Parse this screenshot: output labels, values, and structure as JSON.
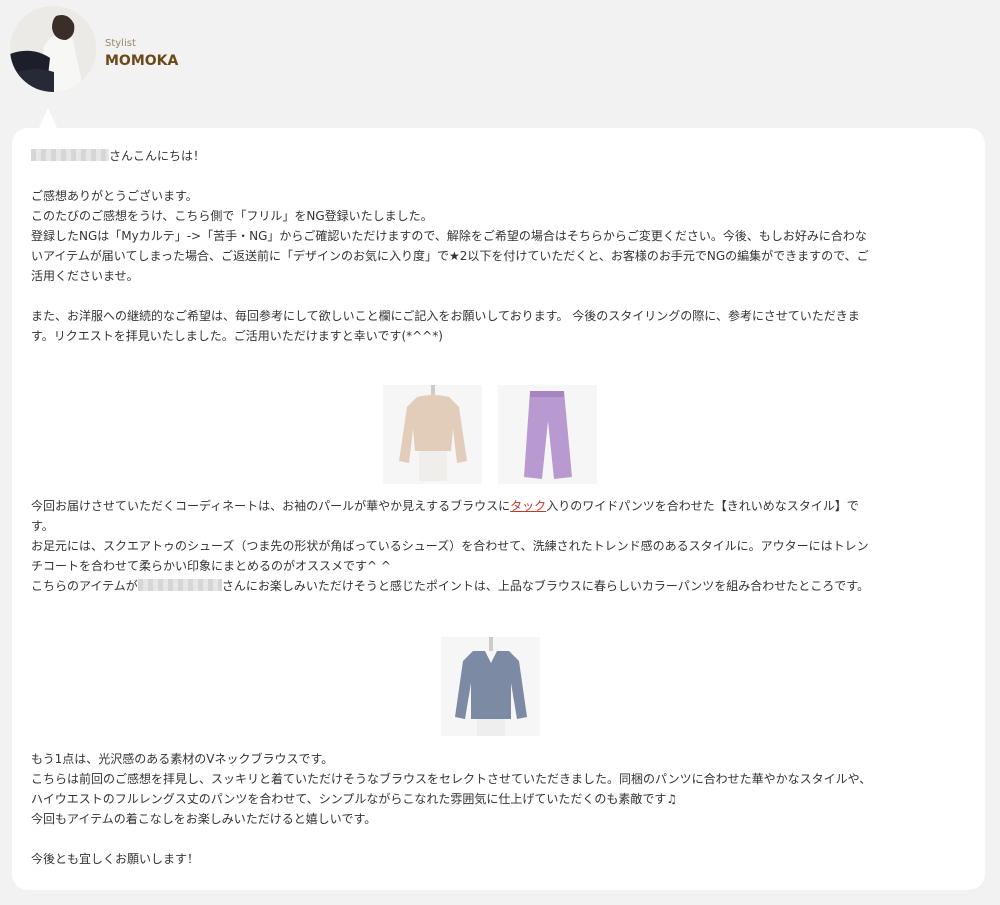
{
  "stylist": {
    "role": "Stylist",
    "name": "MOMOKA",
    "avatar_icon": "stylist-photo"
  },
  "message": {
    "greeting": "さんこんにちは！",
    "p1_l1": "ご感想ありがとうございます。",
    "p1_l2": "このたびのご感想をうけ、こちら側で「フリル」をNG登録いたしました。",
    "p1_l3": "登録したNGは「Myカルテ」->「苦手・NG」からご確認いただけますので、解除をご希望の場合はそちらからご変更ください。今後、もしお好みに合わな",
    "p1_l4": "いアイテムが届いてしまった場合、ご返送前に「デザインのお気に入り度」で★2以下を付けていただくと、お客様のお手元でNGの編集ができますので、ご",
    "p1_l5": "活用くださいませ。",
    "p2_l1": "また、お洋服への継続的なご希望は、毎回参考にして欲しいこと欄にご記入をお願いしております。 今後のスタイリングの際に、参考にさせていただきま",
    "p2_l2": "す。リクエストを拝見いたしました。ご活用いただけますと幸いです(*^^*)",
    "p3_l1_before": "今回お届けさせていただくコーディネートは、お袖のパールが華やか見えするブラウスに",
    "p3_l1_link": "タック",
    "p3_l1_after": "入りのワイドパンツを合わせた【きれいめなスタイル】で",
    "p3_l2": "す。",
    "p3_l3": "お足元には、スクエアトゥのシューズ（つま先の形状が角ばっているシューズ）を合わせて、洗練されたトレンド感のあるスタイルに。アウターにはトレン",
    "p3_l4": "チコートを合わせて柔らかい印象にまとめるのがオススメです^ ^",
    "p3_l5_before": "こちらのアイテムが",
    "p3_l5_after": "さんにお楽しみいただけそうと感じたポイントは、上品なブラウスに春らしいカラーパンツを組み合わせたところです。",
    "p4_l1": "もう1点は、光沢感のある素材のVネックブラウスです。",
    "p4_l2": "こちらは前回のご感想を拝見し、スッキリと着ていただけそうなブラウスをセレクトさせていただきました。同梱のパンツに合わせた華やかなスタイルや、",
    "p4_l3": "ハイウエストのフルレングス丈のパンツを合わせて、シンプルながらこなれた雰囲気に仕上げていただくのも素敵です♫",
    "p4_l4": "今回もアイテムの着こなしをお楽しみいただけると嬉しいです。",
    "closing": "今後とも宜しくお願いします！"
  },
  "products": [
    {
      "icon": "beige-blouse-photo",
      "color": "#e2cdbb"
    },
    {
      "icon": "lavender-wide-pants-photo",
      "color": "#b99ad0"
    },
    {
      "icon": "blue-vneck-blouse-photo",
      "color": "#7d8aa4"
    }
  ]
}
